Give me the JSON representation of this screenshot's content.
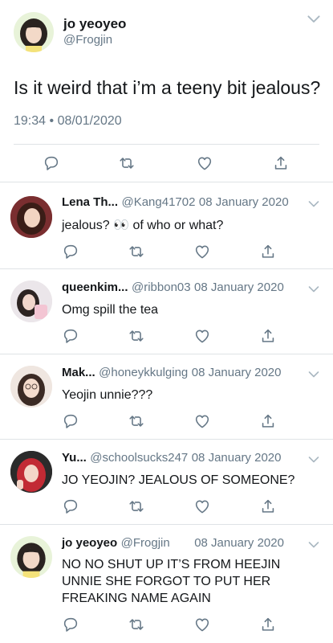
{
  "main_tweet": {
    "name": "jo yeoyeo",
    "handle": "@Frogjin",
    "text": "Is it weird that i’m a teeny bit jealous?",
    "time": "19:34",
    "dot": "•",
    "date": "08/01/2020"
  },
  "replies": [
    {
      "name": "Lena Th...",
      "handle": "@Kang41702",
      "date": "08 January 2020",
      "text_before": "jealous?",
      "emoji": "👀",
      "text_after": "of who or what?"
    },
    {
      "name": "queenkim...",
      "handle": "@ribbon03",
      "date": "08 January 2020",
      "text": "Omg spill the tea"
    },
    {
      "name": "Mak...",
      "handle": "@honeykkulging",
      "date": "08 January 2020",
      "text": "Yeojin unnie???"
    },
    {
      "name": "Yu...",
      "handle": "@schoolsucks247",
      "date": "08 January 2020",
      "text": "JO YEOJIN? JEALOUS OF SOMEONE?"
    },
    {
      "name": "jo yeoyeo",
      "handle": "@Frogjin",
      "date": "08 January 2020",
      "text_lines": [
        "NO NO SHUT UP IT’S FROM HEEJIN",
        "UNNIE SHE FORGOT TO PUT HER",
        "FREAKING NAME AGAIN"
      ]
    }
  ],
  "colors": {
    "accent": "#1da1f2",
    "icon_gray": "#657786",
    "text": "#14171a",
    "divider": "#dfe3e6"
  },
  "icons": [
    "reply-icon",
    "retweet-icon",
    "like-icon",
    "share-icon",
    "chevron-down-icon"
  ]
}
